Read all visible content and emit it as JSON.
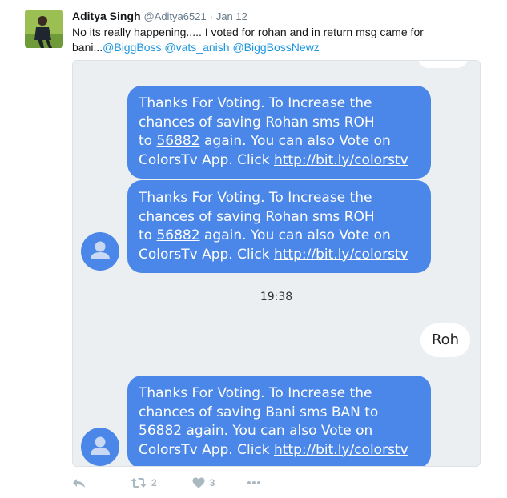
{
  "tweet": {
    "name": "Aditya Singh",
    "handle": "@Aditya6521",
    "separator": "·",
    "date": "Jan 12",
    "text_plain": "No its really happening..... I voted for rohan and in return msg came for bani...",
    "mentions": [
      "@BiggBoss",
      "@vats_anish",
      "@BiggBossNewz"
    ]
  },
  "sms": {
    "message_1": {
      "line1": "Thanks For Voting. To Increase the",
      "line2": "chances of saving Rohan sms ROH",
      "line3_pre": "to ",
      "number": "56882",
      "line3_post": " again. You can also Vote on",
      "line4_pre": "ColorsTv App. Click ",
      "link": "http://bit.ly/colorstv"
    },
    "message_2": {
      "line1": "Thanks For Voting. To Increase the",
      "line2": "chances of saving Rohan sms ROH",
      "line3_pre": "to ",
      "number": "56882",
      "line3_post": " again. You can also Vote on",
      "line4_pre": "ColorsTv App. Click ",
      "link": "http://bit.ly/colorstv"
    },
    "timestamp": "19:38",
    "reply": "Roh",
    "message_3": {
      "line1": "Thanks For Voting. To Increase the",
      "line2": "chances of saving Bani sms BAN to",
      "number": "56882",
      "line3_post": " again. You can also Vote on",
      "line4_pre": "ColorsTv App. Click ",
      "link": "http://bit.ly/colorstv"
    }
  },
  "actions": {
    "retweet_count": "2",
    "like_count": "3"
  },
  "colors": {
    "bubble_blue": "#4a87e9",
    "mention_blue": "#1b95e0",
    "icon_gray": "#aab8c2"
  }
}
